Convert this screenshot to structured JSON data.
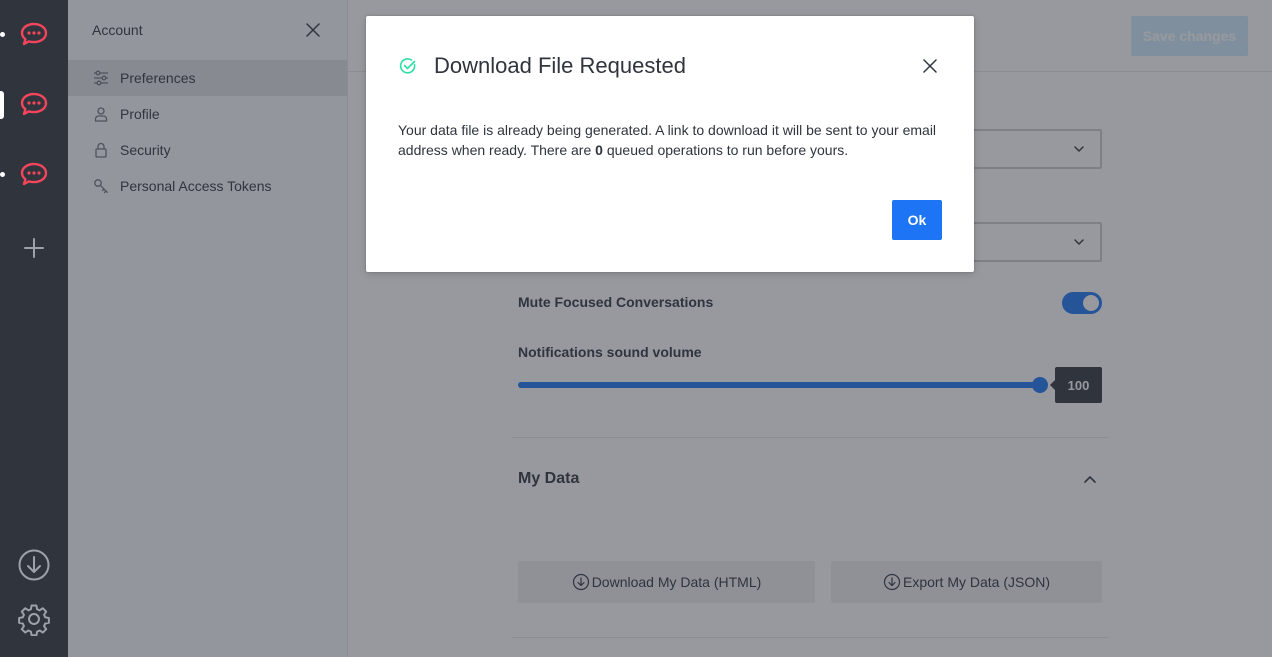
{
  "rail": {
    "servers": [
      {
        "name": "server-1",
        "active": false
      },
      {
        "name": "server-2",
        "active": true
      },
      {
        "name": "server-3",
        "active": false
      }
    ],
    "add_icon": "plus-icon",
    "download_icon": "download-circle-icon",
    "settings_icon": "gear-icon",
    "brand_color": "#f5455c"
  },
  "sidebar": {
    "title": "Account",
    "items": [
      {
        "label": "Preferences",
        "icon": "sliders-icon",
        "active": true
      },
      {
        "label": "Profile",
        "icon": "user-icon",
        "active": false
      },
      {
        "label": "Security",
        "icon": "lock-icon",
        "active": false
      },
      {
        "label": "Personal Access Tokens",
        "icon": "key-icon",
        "active": false
      }
    ]
  },
  "main": {
    "save_label": "Save changes",
    "mute_label": "Mute Focused Conversations",
    "mute_enabled": true,
    "volume_label": "Notifications sound volume",
    "volume_value": "100",
    "my_data_title": "My Data",
    "download_html_label": "Download My Data (HTML)",
    "export_json_label": "Export My Data (JSON)"
  },
  "modal": {
    "title": "Download File Requested",
    "body_before": "Your data file is already being generated. A link to download it will be sent to your email address when ready. There are ",
    "body_count": "0",
    "body_after": " queued operations to run before yours.",
    "ok_label": "Ok",
    "status_color": "#2de0a5",
    "accent_color": "#1d74f5"
  }
}
